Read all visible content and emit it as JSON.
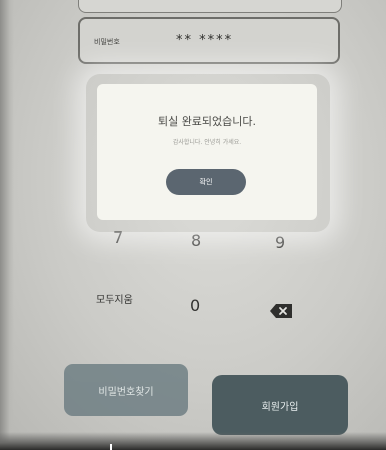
{
  "login": {
    "password_label": "비밀번호",
    "password_value": "** ****"
  },
  "modal": {
    "title": "퇴실 완료되었습니다.",
    "subtitle": "감사합니다. 안녕히 가세요.",
    "confirm_label": "확인"
  },
  "keypad": {
    "row3": [
      "7",
      "8",
      "9"
    ],
    "clear_label": "모두지움",
    "zero": "0",
    "backspace_icon": "backspace-icon"
  },
  "actions": {
    "find_password_label": "비밀번호찾기",
    "sign_up_label": "회원가입"
  }
}
